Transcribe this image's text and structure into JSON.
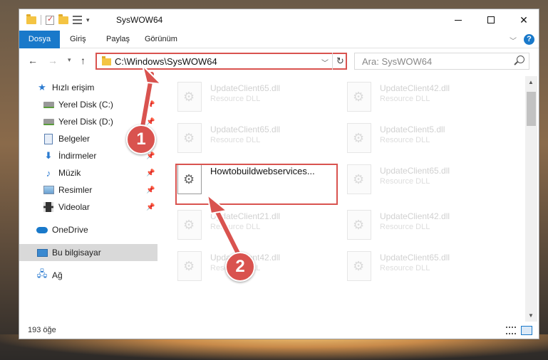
{
  "window": {
    "title": "SysWOW64"
  },
  "ribbon": {
    "tabs": [
      {
        "label": "Dosya"
      },
      {
        "label": "Giriş"
      },
      {
        "label": "Paylaş"
      },
      {
        "label": "Görünüm"
      }
    ]
  },
  "nav": {
    "address": "C:\\Windows\\SysWOW64",
    "search_placeholder": "Ara: SysWOW64"
  },
  "sidebar": {
    "items": [
      {
        "label": "Hızlı erişim",
        "icon": "star-icon",
        "pinned": false
      },
      {
        "label": "Yerel Disk (C:)",
        "icon": "disk-icon",
        "pinned": true
      },
      {
        "label": "Yerel Disk (D:)",
        "icon": "disk-icon",
        "pinned": true
      },
      {
        "label": "Belgeler",
        "icon": "documents-icon",
        "pinned": true
      },
      {
        "label": "İndirmeler",
        "icon": "download-icon",
        "pinned": true
      },
      {
        "label": "Müzik",
        "icon": "music-icon",
        "pinned": true
      },
      {
        "label": "Resimler",
        "icon": "pictures-icon",
        "pinned": true
      },
      {
        "label": "Videolar",
        "icon": "videos-icon",
        "pinned": true
      },
      {
        "label": "OneDrive",
        "icon": "cloud-icon",
        "pinned": false
      },
      {
        "label": "Bu bilgisayar",
        "icon": "computer-icon",
        "pinned": false,
        "selected": true
      },
      {
        "label": "Ağ",
        "icon": "network-icon",
        "pinned": false
      }
    ]
  },
  "files": [
    {
      "name": "UpdateClient65.dll",
      "type": "Resource DLL"
    },
    {
      "name": "UpdateClient42.dll",
      "type": "Resource DLL"
    },
    {
      "name": "UpdateClient65.dll",
      "type": "Resource DLL"
    },
    {
      "name": "UpdateClient5.dll",
      "type": "Resource DLL"
    },
    {
      "name": "Howtobuildwebservices...",
      "type": "",
      "selected": true
    },
    {
      "name": "UpdateClient65.dll",
      "type": "Resource DLL"
    },
    {
      "name": "UpdateClient21.dll",
      "type": "Resource DLL"
    },
    {
      "name": "UpdateClient42.dll",
      "type": "Resource DLL"
    },
    {
      "name": "UpdateClient42.dll",
      "type": "Resource DLL"
    },
    {
      "name": "UpdateClient65.dll",
      "type": "Resource DLL"
    }
  ],
  "status": {
    "count": "193 öğe"
  },
  "annotations": {
    "step1": "1",
    "step2": "2",
    "color": "#d9534f"
  },
  "colors": {
    "accent": "#1979ca",
    "highlight": "#d9534f"
  }
}
